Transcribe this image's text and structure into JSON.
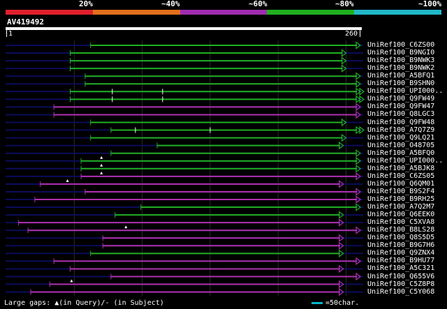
{
  "legend": {
    "labels": [
      "20%",
      "~40%",
      "~60%",
      "~80%",
      "~100%"
    ],
    "colors": [
      "#e0202c",
      "#e0701c",
      "#a02cb0",
      "#20b020",
      "#20b8c8"
    ]
  },
  "query": {
    "name": "AV419492",
    "start_label": "1",
    "end_label": "260",
    "length": 260
  },
  "colors": {
    "green": "#20b020",
    "magenta": "#b030b0",
    "navy": "#0c0c5c",
    "grid": "#2a2a2a",
    "gap_marker": "#ffffff",
    "scale_bar": "#00b8c8"
  },
  "hits": [
    {
      "label": "UniRef100_C6ZS00",
      "color": "green",
      "start": 62,
      "end": 270,
      "arrow": "single"
    },
    {
      "label": "UniRef100_B9NGI0",
      "color": "green",
      "start": 47,
      "end": 250,
      "arrow": "single"
    },
    {
      "label": "UniRef100_B9NWK3",
      "color": "green",
      "start": 47,
      "end": 250,
      "arrow": "single"
    },
    {
      "label": "UniRef100_B9NWK2",
      "color": "green",
      "start": 47,
      "end": 250,
      "arrow": "single"
    },
    {
      "label": "UniRef100_A5BFQ1",
      "color": "green",
      "start": 58,
      "end": 275,
      "arrow": "single"
    },
    {
      "label": "UniRef100_B9SHN0",
      "color": "green",
      "start": 58,
      "end": 275,
      "arrow": "single"
    },
    {
      "label": "UniRef100_UPI000..",
      "color": "green",
      "start": 47,
      "end": 262,
      "arrow": "double",
      "gaps_subject": [
        78,
        115
      ]
    },
    {
      "label": "UniRef100_Q9FW49",
      "color": "green",
      "start": 47,
      "end": 262,
      "arrow": "double",
      "gaps_subject": [
        78,
        115
      ]
    },
    {
      "label": "UniRef100_Q9FW47",
      "color": "magenta",
      "start": 35,
      "end": 262,
      "arrow": "single"
    },
    {
      "label": "UniRef100_Q8LGC3",
      "color": "magenta",
      "start": 35,
      "end": 262,
      "arrow": "single"
    },
    {
      "label": "UniRef100_Q9FW48",
      "color": "green",
      "start": 62,
      "end": 250,
      "arrow": "single"
    },
    {
      "label": "UniRef100_A7Q7Z9",
      "color": "green",
      "start": 77,
      "end": 275,
      "arrow": "double",
      "gaps_subject": [
        95,
        150
      ]
    },
    {
      "label": "UniRef100_Q9LQ21",
      "color": "green",
      "start": 62,
      "end": 250,
      "arrow": "single"
    },
    {
      "label": "UniRef100_O48705",
      "color": "green",
      "start": 111,
      "end": 248,
      "arrow": "single"
    },
    {
      "label": "UniRef100_A5BFQ0",
      "color": "green",
      "start": 77,
      "end": 275,
      "arrow": "single"
    },
    {
      "label": "UniRef100_UPI000..",
      "color": "green",
      "start": 55,
      "end": 275,
      "arrow": "single",
      "gaps_query": [
        70
      ]
    },
    {
      "label": "UniRef100_A5BJK8",
      "color": "green",
      "start": 55,
      "end": 275,
      "arrow": "single",
      "gaps_query": [
        70
      ]
    },
    {
      "label": "UniRef100_C6ZS05",
      "color": "magenta",
      "start": 55,
      "end": 275,
      "arrow": "single",
      "gaps_query": [
        70
      ]
    },
    {
      "label": "UniRef100_Q6QM01",
      "color": "magenta",
      "start": 25,
      "end": 248,
      "arrow": "single",
      "gaps_query": [
        45
      ]
    },
    {
      "label": "UniRef100_B9S2F4",
      "color": "magenta",
      "start": 58,
      "end": 275,
      "arrow": "single"
    },
    {
      "label": "UniRef100_B9RH25",
      "color": "magenta",
      "start": 21,
      "end": 275,
      "arrow": "single"
    },
    {
      "label": "UniRef100_A7Q2M7",
      "color": "green",
      "start": 99,
      "end": 275,
      "arrow": "single"
    },
    {
      "label": "UniRef100_Q6EEK0",
      "color": "green",
      "start": 80,
      "end": 248,
      "arrow": "single"
    },
    {
      "label": "UniRef100_C5XVA8",
      "color": "magenta",
      "start": 9,
      "end": 248,
      "arrow": "single"
    },
    {
      "label": "UniRef100_B8LS28",
      "color": "magenta",
      "start": 16,
      "end": 275,
      "arrow": "single",
      "gaps_query": [
        88
      ]
    },
    {
      "label": "UniRef100_Q8S5D5",
      "color": "magenta",
      "start": 71,
      "end": 248,
      "arrow": "single"
    },
    {
      "label": "UniRef100_B9G7H6",
      "color": "magenta",
      "start": 71,
      "end": 248,
      "arrow": "single"
    },
    {
      "label": "UniRef100_Q9ZNX4",
      "color": "green",
      "start": 62,
      "end": 248,
      "arrow": "single"
    },
    {
      "label": "UniRef100_B9HU77",
      "color": "magenta",
      "start": 35,
      "end": 275,
      "arrow": "single"
    },
    {
      "label": "UniRef100_A5C321",
      "color": "magenta",
      "start": 47,
      "end": 248,
      "arrow": "single"
    },
    {
      "label": "UniRef100_Q655V6",
      "color": "magenta",
      "start": 77,
      "end": 275,
      "arrow": "single"
    },
    {
      "label": "UniRef100_C5Z8P8",
      "color": "magenta",
      "start": 32,
      "end": 248,
      "arrow": "single",
      "gaps_query": [
        48
      ]
    },
    {
      "label": "UniRef100_C5Y068",
      "color": "magenta",
      "start": 18,
      "end": 248,
      "arrow": "single"
    }
  ],
  "footer": {
    "gap_legend": "Large gaps: ▲(in Query)/- (in Subject)",
    "scale_text": "=50char."
  }
}
